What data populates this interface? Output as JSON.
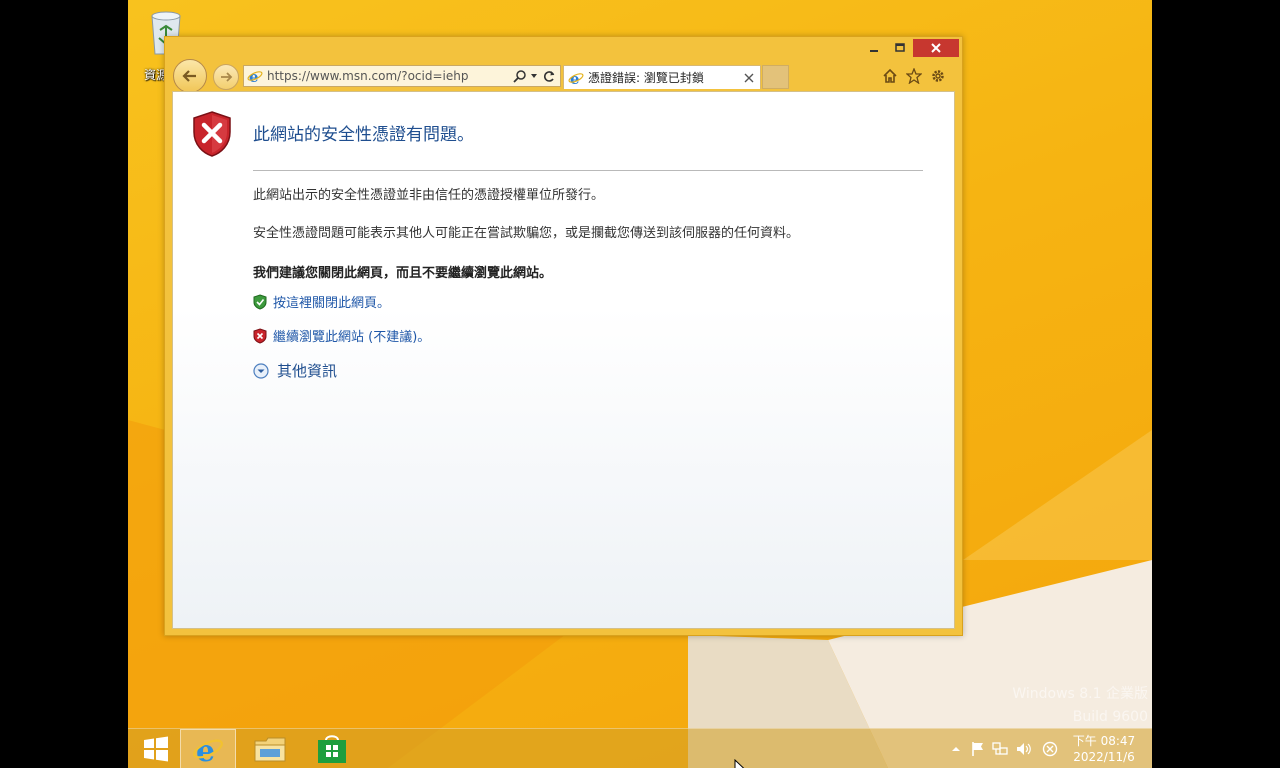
{
  "desktop": {
    "recycle_bin_label": "資源回收筒",
    "watermark_line1": "Windows 8.1 企業版",
    "watermark_line2": "Build 9600"
  },
  "browser": {
    "address_url": "https://www.msn.com/?ocid=iehp",
    "tab_title": "憑證錯誤: 瀏覽已封鎖",
    "accent_color": "#f3c23d",
    "page": {
      "heading": "此網站的安全性憑證有問題。",
      "para1": "此網站出示的安全性憑證並非由信任的憑證授權單位所發行。",
      "para2": "安全性憑證問題可能表示其他人可能正在嘗試欺騙您，或是攔截您傳送到該伺服器的任何資料。",
      "recommendation": "我們建議您關閉此網頁，而且不要繼續瀏覽此網站。",
      "link_close": "按這裡關閉此網頁。",
      "link_continue": "繼續瀏覽此網站 (不建議)。",
      "more_info": "其他資訊"
    }
  },
  "taskbar": {
    "clock_time": "下午 08:47",
    "clock_date": "2022/11/6"
  }
}
